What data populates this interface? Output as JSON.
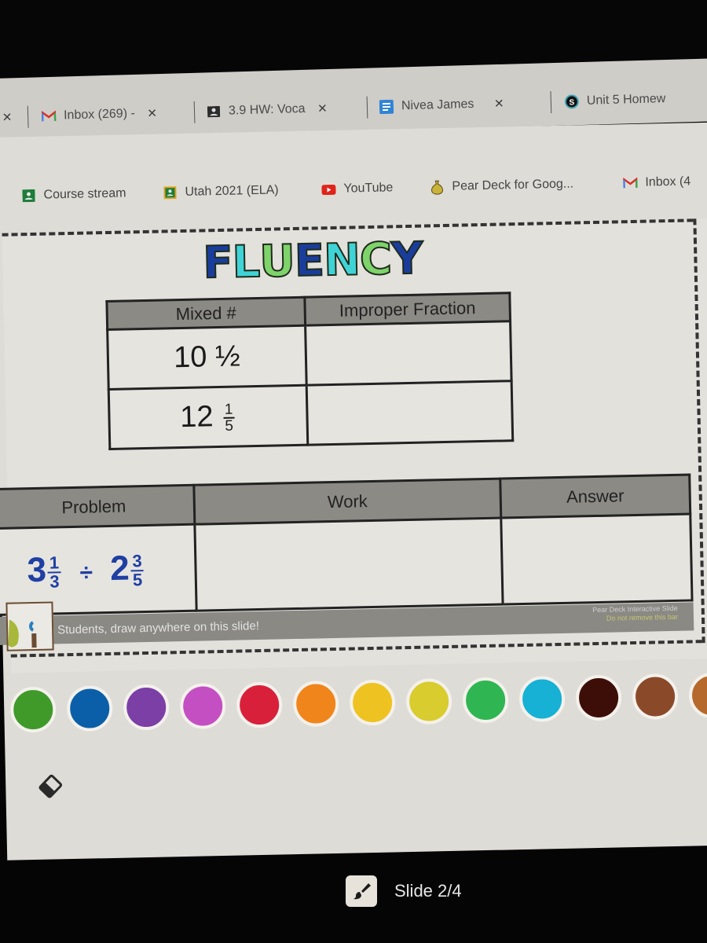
{
  "tabs": [
    {
      "icon": "close-icon",
      "label": "",
      "partial": true
    },
    {
      "icon": "gmail-icon",
      "label": "Inbox (269) - ",
      "close": "×"
    },
    {
      "icon": "google-classroom-icon",
      "label": "3.9 HW: Voca",
      "close": "×"
    },
    {
      "icon": "google-docs-icon",
      "label": "Nivea James",
      "close": "×"
    },
    {
      "icon": "schoology-icon",
      "label": "Unit 5 Homew"
    }
  ],
  "bookmarks": [
    {
      "icon": "google-classroom-icon",
      "label": "Course stream",
      "color": "#1e7d3a"
    },
    {
      "icon": "google-classroom-icon",
      "label": "Utah 2021 (ELA)",
      "color": "#e0a21b"
    },
    {
      "icon": "youtube-icon",
      "label": "YouTube",
      "color": "#e0241b"
    },
    {
      "icon": "pear-deck-icon",
      "label": "Pear Deck for Goog..."
    },
    {
      "icon": "gmail-icon",
      "label": "Inbox (4"
    }
  ],
  "slide": {
    "title_letters": [
      {
        "char": "F",
        "color": "#1a3d9c"
      },
      {
        "char": "L",
        "color": "#3fd3d6"
      },
      {
        "char": "U",
        "color": "#7ed36b"
      },
      {
        "char": "E",
        "color": "#1a3d9c"
      },
      {
        "char": "N",
        "color": "#3fd3d6"
      },
      {
        "char": "C",
        "color": "#7ed36b"
      },
      {
        "char": "Y",
        "color": "#1a3d9c"
      }
    ],
    "fluency_table": {
      "headers": [
        "Mixed #",
        "Improper Fraction"
      ],
      "rows": [
        {
          "whole": "10",
          "fraction_text": "½",
          "numerator": "",
          "denominator": "",
          "answer": ""
        },
        {
          "whole": "12",
          "fraction_text": "",
          "numerator": "1",
          "denominator": "5",
          "answer": ""
        }
      ]
    },
    "problem_table": {
      "headers": [
        "Problem",
        "Work",
        "Answer"
      ],
      "problem": {
        "a_whole": "3",
        "a_num": "1",
        "a_den": "3",
        "operator": "÷",
        "b_whole": "2",
        "b_num": "3",
        "b_den": "5"
      },
      "work": "",
      "answer": ""
    },
    "draw_banner": "Students, draw anywhere on this slide!",
    "pear_deck_badge": "Pear Deck Interactive Slide",
    "pear_deck_badge_sub": "Do not remove this bar"
  },
  "palette": [
    {
      "name": "green",
      "color": "#3f9a2a"
    },
    {
      "name": "blue",
      "color": "#0b5fa8"
    },
    {
      "name": "purple",
      "color": "#7b3fa6"
    },
    {
      "name": "pink",
      "color": "#c44fc2"
    },
    {
      "name": "red",
      "color": "#d9203a"
    },
    {
      "name": "orange",
      "color": "#f0861b"
    },
    {
      "name": "yellow-orange",
      "color": "#eec321"
    },
    {
      "name": "yellow",
      "color": "#d8cc2e"
    },
    {
      "name": "light-green",
      "color": "#2fb653"
    },
    {
      "name": "sky-blue",
      "color": "#16b1d4"
    },
    {
      "name": "dark-brown",
      "color": "#3d0e07"
    },
    {
      "name": "brown",
      "color": "#8a4a2a"
    },
    {
      "name": "tan-brown",
      "color": "#b5692c"
    }
  ],
  "footer": {
    "slide_label": "Slide 2/4"
  }
}
